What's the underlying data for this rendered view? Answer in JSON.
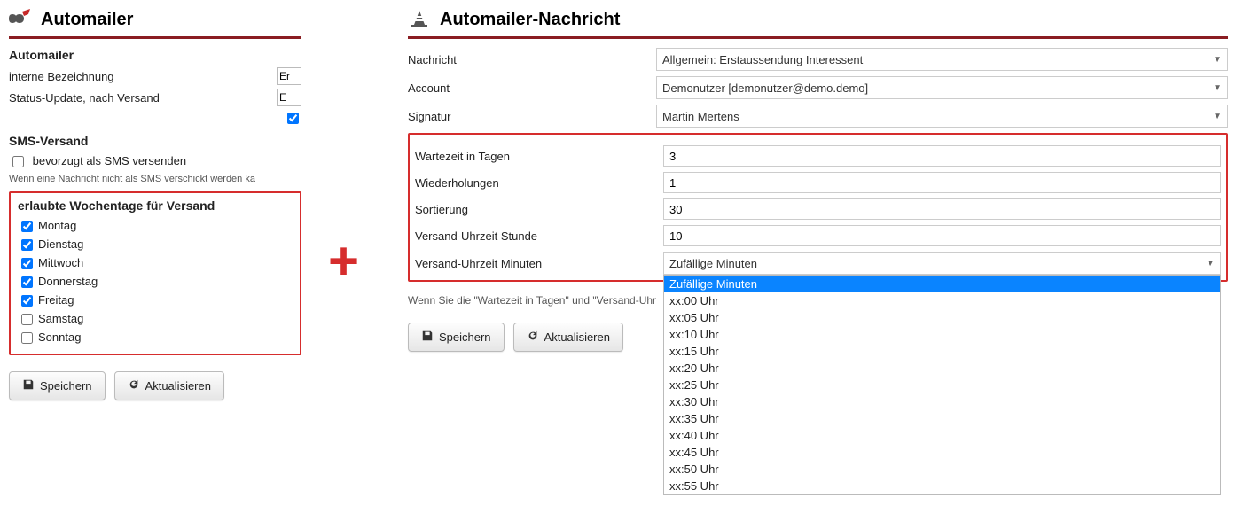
{
  "left": {
    "title": "Automailer",
    "section_identity": "Automailer",
    "rows": {
      "interne_label": "interne Bezeichnung",
      "interne_value": "Er",
      "status_label": "Status-Update, nach Versand",
      "status_value": "E"
    },
    "sms_header": "SMS-Versand",
    "sms_pref_label": "bevorzugt als SMS versenden",
    "sms_note": "Wenn eine Nachricht nicht als SMS verschickt werden ka",
    "days_header": "erlaubte Wochentage für Versand",
    "days": [
      {
        "label": "Montag",
        "checked": true
      },
      {
        "label": "Dienstag",
        "checked": true
      },
      {
        "label": "Mittwoch",
        "checked": true
      },
      {
        "label": "Donnerstag",
        "checked": true
      },
      {
        "label": "Freitag",
        "checked": true
      },
      {
        "label": "Samstag",
        "checked": false
      },
      {
        "label": "Sonntag",
        "checked": false
      }
    ],
    "save_label": "Speichern",
    "refresh_label": "Aktualisieren"
  },
  "right": {
    "title": "Automailer-Nachricht",
    "nachricht_label": "Nachricht",
    "nachricht_value": "Allgemein: Erstaussendung Interessent",
    "account_label": "Account",
    "account_value": "Demonutzer [demonutzer@demo.demo]",
    "signatur_label": "Signatur",
    "signatur_value": "Martin Mertens",
    "wartezeit_label": "Wartezeit in Tagen",
    "wartezeit_value": "3",
    "wieder_label": "Wiederholungen",
    "wieder_value": "1",
    "sort_label": "Sortierung",
    "sort_value": "30",
    "stunde_label": "Versand-Uhrzeit Stunde",
    "stunde_value": "10",
    "minuten_label": "Versand-Uhrzeit Minuten",
    "minuten_value": "Zufällige Minuten",
    "minuten_options": [
      "Zufällige Minuten",
      "xx:00 Uhr",
      "xx:05 Uhr",
      "xx:10 Uhr",
      "xx:15 Uhr",
      "xx:20 Uhr",
      "xx:25 Uhr",
      "xx:30 Uhr",
      "xx:35 Uhr",
      "xx:40 Uhr",
      "xx:45 Uhr",
      "xx:50 Uhr",
      "xx:55 Uhr"
    ],
    "hint": "Wenn Sie die \"Wartezeit in Tagen\" und \"Versand-Uhr",
    "save_label": "Speichern",
    "refresh_label": "Aktualisieren"
  },
  "plus": "+"
}
